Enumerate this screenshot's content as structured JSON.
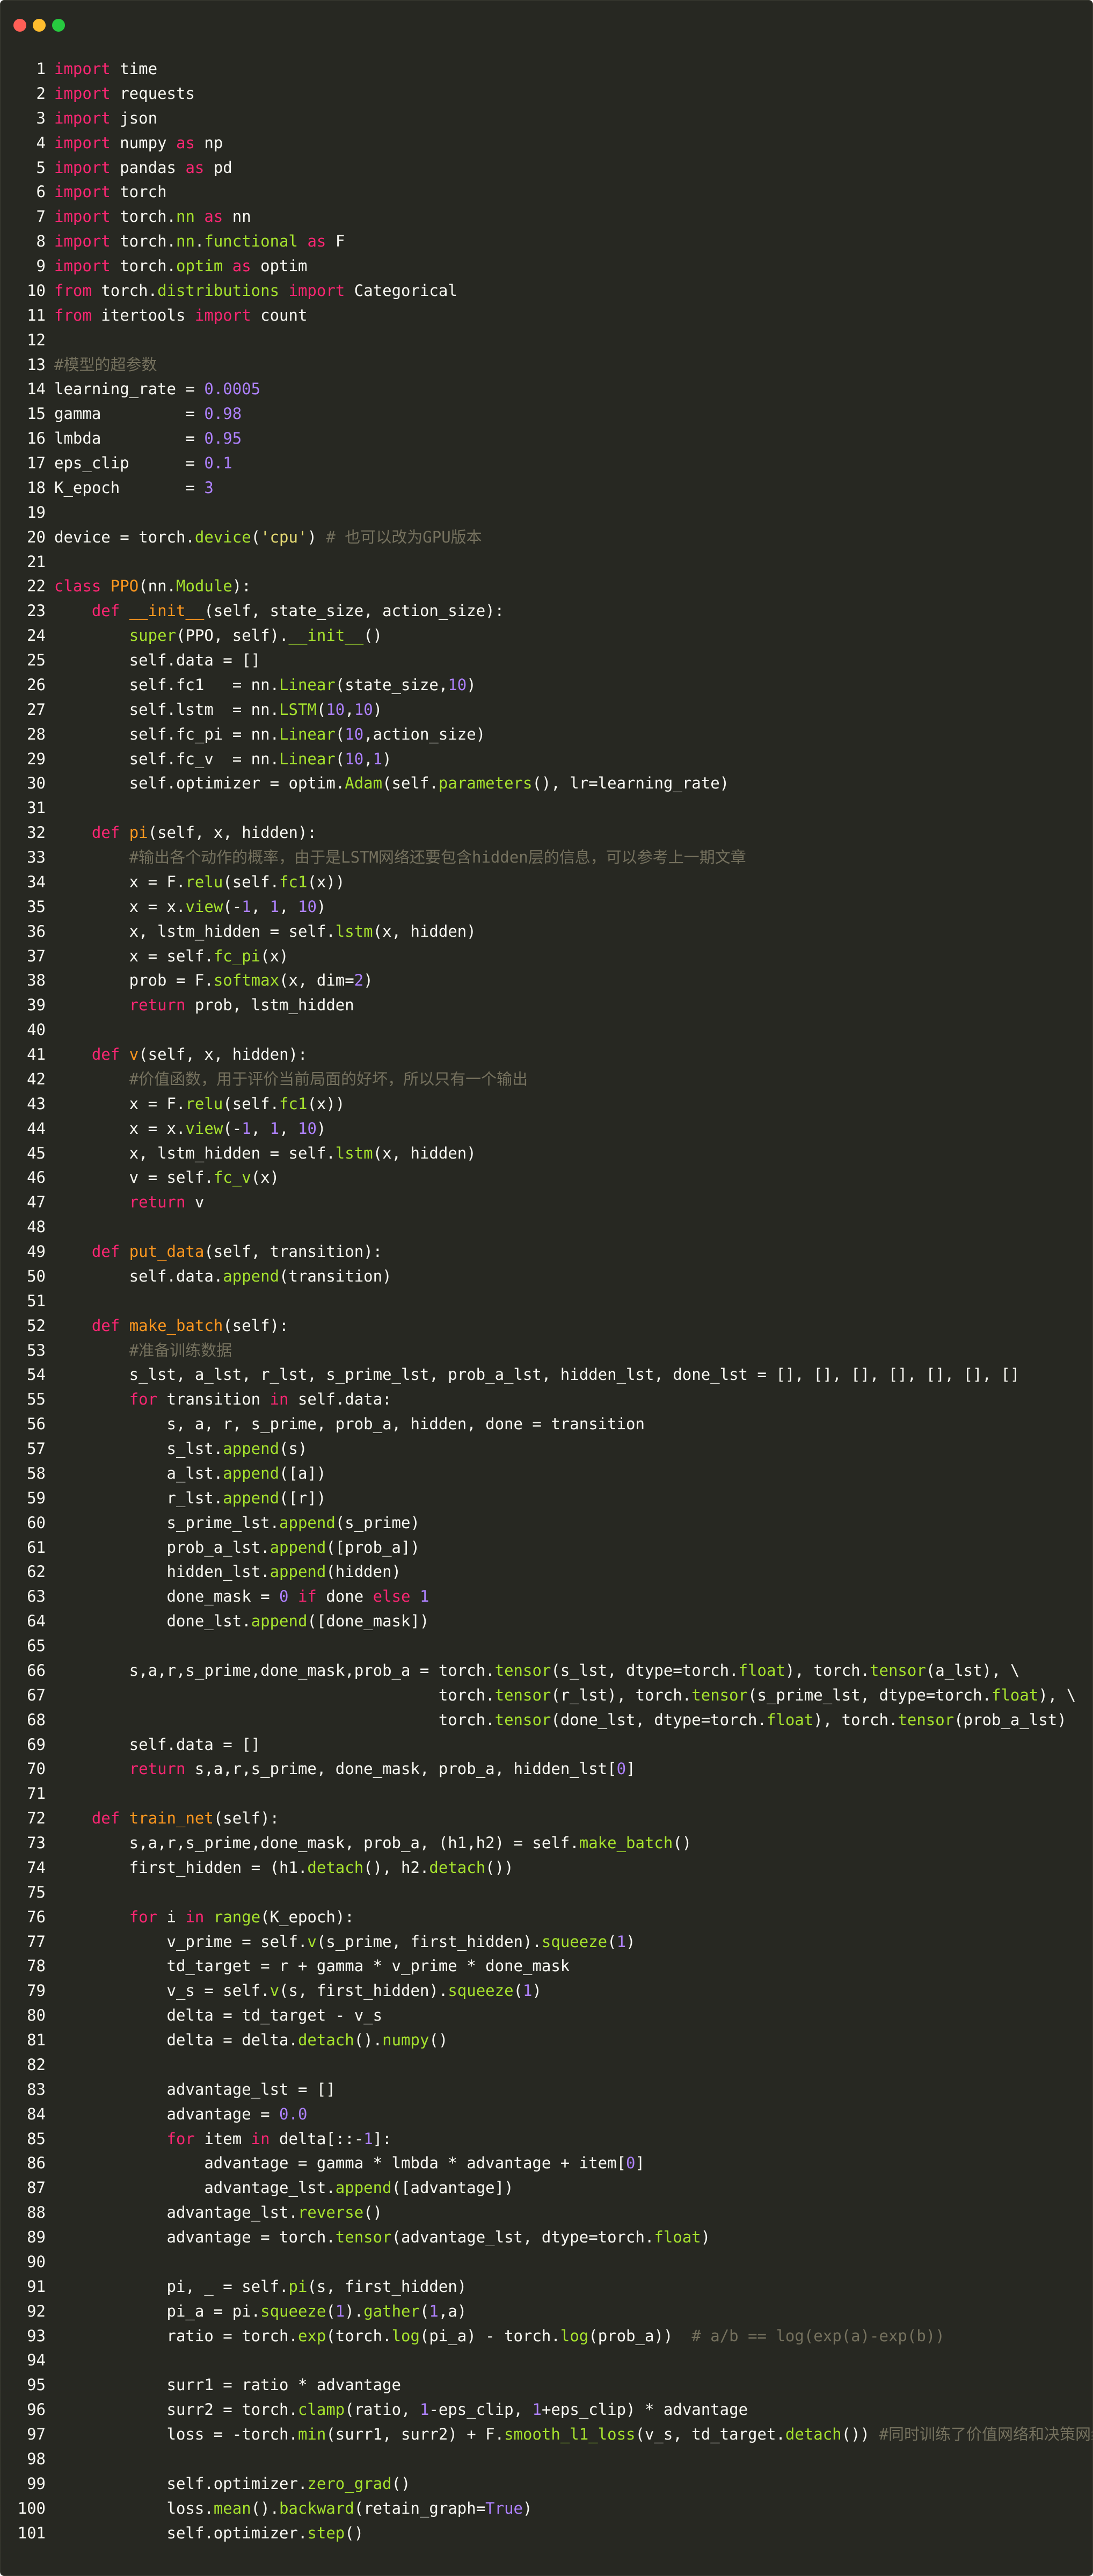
{
  "window": {
    "buttons": [
      {
        "name": "close-window-button",
        "color": "#ff5f56"
      },
      {
        "name": "minimize-window-button",
        "color": "#ffbd2e"
      },
      {
        "name": "maximize-window-button",
        "color": "#27c93f"
      }
    ]
  },
  "code_lines": [
    [
      [
        "k",
        "import"
      ],
      [
        "p",
        " time"
      ]
    ],
    [
      [
        "k",
        "import"
      ],
      [
        "p",
        " requests"
      ]
    ],
    [
      [
        "k",
        "import"
      ],
      [
        "p",
        " json"
      ]
    ],
    [
      [
        "k",
        "import"
      ],
      [
        "p",
        " numpy "
      ],
      [
        "k",
        "as"
      ],
      [
        "p",
        " np"
      ]
    ],
    [
      [
        "k",
        "import"
      ],
      [
        "p",
        " pandas "
      ],
      [
        "k",
        "as"
      ],
      [
        "p",
        " pd"
      ]
    ],
    [
      [
        "k",
        "import"
      ],
      [
        "p",
        " torch"
      ]
    ],
    [
      [
        "k",
        "import"
      ],
      [
        "p",
        " torch."
      ],
      [
        "f",
        "nn"
      ],
      [
        "p",
        " "
      ],
      [
        "k",
        "as"
      ],
      [
        "p",
        " nn"
      ]
    ],
    [
      [
        "k",
        "import"
      ],
      [
        "p",
        " torch."
      ],
      [
        "f",
        "nn"
      ],
      [
        "p",
        "."
      ],
      [
        "f",
        "functional"
      ],
      [
        "p",
        " "
      ],
      [
        "k",
        "as"
      ],
      [
        "p",
        " F"
      ]
    ],
    [
      [
        "k",
        "import"
      ],
      [
        "p",
        " torch."
      ],
      [
        "f",
        "optim"
      ],
      [
        "p",
        " "
      ],
      [
        "k",
        "as"
      ],
      [
        "p",
        " optim"
      ]
    ],
    [
      [
        "k",
        "from"
      ],
      [
        "p",
        " torch."
      ],
      [
        "f",
        "distributions"
      ],
      [
        "p",
        " "
      ],
      [
        "k",
        "import"
      ],
      [
        "p",
        " Categorical"
      ]
    ],
    [
      [
        "k",
        "from"
      ],
      [
        "p",
        " itertools "
      ],
      [
        "k",
        "import"
      ],
      [
        "p",
        " count"
      ]
    ],
    [],
    [
      [
        "c",
        "#模型的超参数"
      ]
    ],
    [
      [
        "p",
        "learning_rate = "
      ],
      [
        "n",
        "0.0005"
      ]
    ],
    [
      [
        "p",
        "gamma         = "
      ],
      [
        "n",
        "0.98"
      ]
    ],
    [
      [
        "p",
        "lmbda         = "
      ],
      [
        "n",
        "0.95"
      ]
    ],
    [
      [
        "p",
        "eps_clip      = "
      ],
      [
        "n",
        "0.1"
      ]
    ],
    [
      [
        "p",
        "K_epoch       = "
      ],
      [
        "n",
        "3"
      ]
    ],
    [],
    [
      [
        "p",
        "device = torch."
      ],
      [
        "f",
        "device"
      ],
      [
        "p",
        "("
      ],
      [
        "s",
        "'cpu'"
      ],
      [
        "p",
        ") "
      ],
      [
        "c",
        "# 也可以改为GPU版本"
      ]
    ],
    [],
    [
      [
        "k",
        "class"
      ],
      [
        "p",
        " "
      ],
      [
        "d",
        "PPO"
      ],
      [
        "p",
        "(nn."
      ],
      [
        "f",
        "Module"
      ],
      [
        "p",
        "):"
      ]
    ],
    [
      [
        "p",
        "    "
      ],
      [
        "k",
        "def"
      ],
      [
        "p",
        " "
      ],
      [
        "d",
        "__init__"
      ],
      [
        "p",
        "(self, state_size, action_size):"
      ]
    ],
    [
      [
        "p",
        "        "
      ],
      [
        "f",
        "super"
      ],
      [
        "p",
        "(PPO, self)."
      ],
      [
        "f",
        "__init__"
      ],
      [
        "p",
        "()"
      ]
    ],
    [
      [
        "p",
        "        self.data = []"
      ]
    ],
    [
      [
        "p",
        "        self.fc1   = nn."
      ],
      [
        "f",
        "Linear"
      ],
      [
        "p",
        "(state_size,"
      ],
      [
        "n",
        "10"
      ],
      [
        "p",
        ")"
      ]
    ],
    [
      [
        "p",
        "        self.lstm  = nn."
      ],
      [
        "f",
        "LSTM"
      ],
      [
        "p",
        "("
      ],
      [
        "n",
        "10"
      ],
      [
        "p",
        ","
      ],
      [
        "n",
        "10"
      ],
      [
        "p",
        ")"
      ]
    ],
    [
      [
        "p",
        "        self.fc_pi = nn."
      ],
      [
        "f",
        "Linear"
      ],
      [
        "p",
        "("
      ],
      [
        "n",
        "10"
      ],
      [
        "p",
        ",action_size)"
      ]
    ],
    [
      [
        "p",
        "        self.fc_v  = nn."
      ],
      [
        "f",
        "Linear"
      ],
      [
        "p",
        "("
      ],
      [
        "n",
        "10"
      ],
      [
        "p",
        ","
      ],
      [
        "n",
        "1"
      ],
      [
        "p",
        ")"
      ]
    ],
    [
      [
        "p",
        "        self.optimizer = optim."
      ],
      [
        "f",
        "Adam"
      ],
      [
        "p",
        "(self."
      ],
      [
        "f",
        "parameters"
      ],
      [
        "p",
        "(), lr=learning_rate)"
      ]
    ],
    [],
    [
      [
        "p",
        "    "
      ],
      [
        "k",
        "def"
      ],
      [
        "p",
        " "
      ],
      [
        "d",
        "pi"
      ],
      [
        "p",
        "(self, x, hidden):"
      ]
    ],
    [
      [
        "p",
        "        "
      ],
      [
        "c",
        "#输出各个动作的概率，由于是LSTM网络还要包含hidden层的信息，可以参考上一期文章"
      ]
    ],
    [
      [
        "p",
        "        x = F."
      ],
      [
        "f",
        "relu"
      ],
      [
        "p",
        "(self."
      ],
      [
        "f",
        "fc1"
      ],
      [
        "p",
        "(x))"
      ]
    ],
    [
      [
        "p",
        "        x = x."
      ],
      [
        "f",
        "view"
      ],
      [
        "p",
        "(-"
      ],
      [
        "n",
        "1"
      ],
      [
        "p",
        ", "
      ],
      [
        "n",
        "1"
      ],
      [
        "p",
        ", "
      ],
      [
        "n",
        "10"
      ],
      [
        "p",
        ")"
      ]
    ],
    [
      [
        "p",
        "        x, lstm_hidden = self."
      ],
      [
        "f",
        "lstm"
      ],
      [
        "p",
        "(x, hidden)"
      ]
    ],
    [
      [
        "p",
        "        x = self."
      ],
      [
        "f",
        "fc_pi"
      ],
      [
        "p",
        "(x)"
      ]
    ],
    [
      [
        "p",
        "        prob = F."
      ],
      [
        "f",
        "softmax"
      ],
      [
        "p",
        "(x, dim="
      ],
      [
        "n",
        "2"
      ],
      [
        "p",
        ")"
      ]
    ],
    [
      [
        "p",
        "        "
      ],
      [
        "k",
        "return"
      ],
      [
        "p",
        " prob, lstm_hidden"
      ]
    ],
    [],
    [
      [
        "p",
        "    "
      ],
      [
        "k",
        "def"
      ],
      [
        "p",
        " "
      ],
      [
        "d",
        "v"
      ],
      [
        "p",
        "(self, x, hidden):"
      ]
    ],
    [
      [
        "p",
        "        "
      ],
      [
        "c",
        "#价值函数，用于评价当前局面的好坏，所以只有一个输出"
      ]
    ],
    [
      [
        "p",
        "        x = F."
      ],
      [
        "f",
        "relu"
      ],
      [
        "p",
        "(self."
      ],
      [
        "f",
        "fc1"
      ],
      [
        "p",
        "(x))"
      ]
    ],
    [
      [
        "p",
        "        x = x."
      ],
      [
        "f",
        "view"
      ],
      [
        "p",
        "(-"
      ],
      [
        "n",
        "1"
      ],
      [
        "p",
        ", "
      ],
      [
        "n",
        "1"
      ],
      [
        "p",
        ", "
      ],
      [
        "n",
        "10"
      ],
      [
        "p",
        ")"
      ]
    ],
    [
      [
        "p",
        "        x, lstm_hidden = self."
      ],
      [
        "f",
        "lstm"
      ],
      [
        "p",
        "(x, hidden)"
      ]
    ],
    [
      [
        "p",
        "        v = self."
      ],
      [
        "f",
        "fc_v"
      ],
      [
        "p",
        "(x)"
      ]
    ],
    [
      [
        "p",
        "        "
      ],
      [
        "k",
        "return"
      ],
      [
        "p",
        " v"
      ]
    ],
    [],
    [
      [
        "p",
        "    "
      ],
      [
        "k",
        "def"
      ],
      [
        "p",
        " "
      ],
      [
        "d",
        "put_data"
      ],
      [
        "p",
        "(self, transition):"
      ]
    ],
    [
      [
        "p",
        "        self.data."
      ],
      [
        "f",
        "append"
      ],
      [
        "p",
        "(transition)"
      ]
    ],
    [],
    [
      [
        "p",
        "    "
      ],
      [
        "k",
        "def"
      ],
      [
        "p",
        " "
      ],
      [
        "d",
        "make_batch"
      ],
      [
        "p",
        "(self):"
      ]
    ],
    [
      [
        "p",
        "        "
      ],
      [
        "c",
        "#准备训练数据"
      ]
    ],
    [
      [
        "p",
        "        s_lst, a_lst, r_lst, s_prime_lst, prob_a_lst, hidden_lst, done_lst = [], [], [], [], [], [], []"
      ]
    ],
    [
      [
        "p",
        "        "
      ],
      [
        "k",
        "for"
      ],
      [
        "p",
        " transition "
      ],
      [
        "k",
        "in"
      ],
      [
        "p",
        " self.data:"
      ]
    ],
    [
      [
        "p",
        "            s, a, r, s_prime, prob_a, hidden, done = transition"
      ]
    ],
    [
      [
        "p",
        "            s_lst."
      ],
      [
        "f",
        "append"
      ],
      [
        "p",
        "(s)"
      ]
    ],
    [
      [
        "p",
        "            a_lst."
      ],
      [
        "f",
        "append"
      ],
      [
        "p",
        "([a])"
      ]
    ],
    [
      [
        "p",
        "            r_lst."
      ],
      [
        "f",
        "append"
      ],
      [
        "p",
        "([r])"
      ]
    ],
    [
      [
        "p",
        "            s_prime_lst."
      ],
      [
        "f",
        "append"
      ],
      [
        "p",
        "(s_prime)"
      ]
    ],
    [
      [
        "p",
        "            prob_a_lst."
      ],
      [
        "f",
        "append"
      ],
      [
        "p",
        "([prob_a])"
      ]
    ],
    [
      [
        "p",
        "            hidden_lst."
      ],
      [
        "f",
        "append"
      ],
      [
        "p",
        "(hidden)"
      ]
    ],
    [
      [
        "p",
        "            done_mask = "
      ],
      [
        "n",
        "0"
      ],
      [
        "p",
        " "
      ],
      [
        "k",
        "if"
      ],
      [
        "p",
        " done "
      ],
      [
        "k",
        "else"
      ],
      [
        "p",
        " "
      ],
      [
        "n",
        "1"
      ]
    ],
    [
      [
        "p",
        "            done_lst."
      ],
      [
        "f",
        "append"
      ],
      [
        "p",
        "([done_mask])"
      ]
    ],
    [],
    [
      [
        "p",
        "        s,a,r,s_prime,done_mask,prob_a = torch."
      ],
      [
        "f",
        "tensor"
      ],
      [
        "p",
        "(s_lst, dtype=torch."
      ],
      [
        "f",
        "float"
      ],
      [
        "p",
        "), torch."
      ],
      [
        "f",
        "tensor"
      ],
      [
        "p",
        "(a_lst), \\"
      ]
    ],
    [
      [
        "p",
        "                                         torch."
      ],
      [
        "f",
        "tensor"
      ],
      [
        "p",
        "(r_lst), torch."
      ],
      [
        "f",
        "tensor"
      ],
      [
        "p",
        "(s_prime_lst, dtype=torch."
      ],
      [
        "f",
        "float"
      ],
      [
        "p",
        "), \\"
      ]
    ],
    [
      [
        "p",
        "                                         torch."
      ],
      [
        "f",
        "tensor"
      ],
      [
        "p",
        "(done_lst, dtype=torch."
      ],
      [
        "f",
        "float"
      ],
      [
        "p",
        "), torch."
      ],
      [
        "f",
        "tensor"
      ],
      [
        "p",
        "(prob_a_lst)"
      ]
    ],
    [
      [
        "p",
        "        self.data = []"
      ]
    ],
    [
      [
        "p",
        "        "
      ],
      [
        "k",
        "return"
      ],
      [
        "p",
        " s,a,r,s_prime, done_mask, prob_a, hidden_lst["
      ],
      [
        "n",
        "0"
      ],
      [
        "p",
        "]"
      ]
    ],
    [],
    [
      [
        "p",
        "    "
      ],
      [
        "k",
        "def"
      ],
      [
        "p",
        " "
      ],
      [
        "d",
        "train_net"
      ],
      [
        "p",
        "(self):"
      ]
    ],
    [
      [
        "p",
        "        s,a,r,s_prime,done_mask, prob_a, (h1,h2) = self."
      ],
      [
        "f",
        "make_batch"
      ],
      [
        "p",
        "()"
      ]
    ],
    [
      [
        "p",
        "        first_hidden = (h1."
      ],
      [
        "f",
        "detach"
      ],
      [
        "p",
        "(), h2."
      ],
      [
        "f",
        "detach"
      ],
      [
        "p",
        "())"
      ]
    ],
    [],
    [
      [
        "p",
        "        "
      ],
      [
        "k",
        "for"
      ],
      [
        "p",
        " i "
      ],
      [
        "k",
        "in"
      ],
      [
        "p",
        " "
      ],
      [
        "f",
        "range"
      ],
      [
        "p",
        "(K_epoch):"
      ]
    ],
    [
      [
        "p",
        "            v_prime = self."
      ],
      [
        "f",
        "v"
      ],
      [
        "p",
        "(s_prime, first_hidden)."
      ],
      [
        "f",
        "squeeze"
      ],
      [
        "p",
        "("
      ],
      [
        "n",
        "1"
      ],
      [
        "p",
        ")"
      ]
    ],
    [
      [
        "p",
        "            td_target = r + gamma * v_prime * done_mask"
      ]
    ],
    [
      [
        "p",
        "            v_s = self."
      ],
      [
        "f",
        "v"
      ],
      [
        "p",
        "(s, first_hidden)."
      ],
      [
        "f",
        "squeeze"
      ],
      [
        "p",
        "("
      ],
      [
        "n",
        "1"
      ],
      [
        "p",
        ")"
      ]
    ],
    [
      [
        "p",
        "            delta = td_target - v_s"
      ]
    ],
    [
      [
        "p",
        "            delta = delta."
      ],
      [
        "f",
        "detach"
      ],
      [
        "p",
        "()."
      ],
      [
        "f",
        "numpy"
      ],
      [
        "p",
        "()"
      ]
    ],
    [],
    [
      [
        "p",
        "            advantage_lst = []"
      ]
    ],
    [
      [
        "p",
        "            advantage = "
      ],
      [
        "n",
        "0.0"
      ]
    ],
    [
      [
        "p",
        "            "
      ],
      [
        "k",
        "for"
      ],
      [
        "p",
        " item "
      ],
      [
        "k",
        "in"
      ],
      [
        "p",
        " delta[::-"
      ],
      [
        "n",
        "1"
      ],
      [
        "p",
        "]:"
      ]
    ],
    [
      [
        "p",
        "                advantage = gamma * lmbda * advantage + item["
      ],
      [
        "n",
        "0"
      ],
      [
        "p",
        "]"
      ]
    ],
    [
      [
        "p",
        "                advantage_lst."
      ],
      [
        "f",
        "append"
      ],
      [
        "p",
        "([advantage])"
      ]
    ],
    [
      [
        "p",
        "            advantage_lst."
      ],
      [
        "f",
        "reverse"
      ],
      [
        "p",
        "()"
      ]
    ],
    [
      [
        "p",
        "            advantage = torch."
      ],
      [
        "f",
        "tensor"
      ],
      [
        "p",
        "(advantage_lst, dtype=torch."
      ],
      [
        "f",
        "float"
      ],
      [
        "p",
        ")"
      ]
    ],
    [],
    [
      [
        "p",
        "            pi, _ = self."
      ],
      [
        "f",
        "pi"
      ],
      [
        "p",
        "(s, first_hidden)"
      ]
    ],
    [
      [
        "p",
        "            pi_a = pi."
      ],
      [
        "f",
        "squeeze"
      ],
      [
        "p",
        "("
      ],
      [
        "n",
        "1"
      ],
      [
        "p",
        ")."
      ],
      [
        "f",
        "gather"
      ],
      [
        "p",
        "("
      ],
      [
        "n",
        "1"
      ],
      [
        "p",
        ",a)"
      ]
    ],
    [
      [
        "p",
        "            ratio = torch."
      ],
      [
        "f",
        "exp"
      ],
      [
        "p",
        "(torch."
      ],
      [
        "f",
        "log"
      ],
      [
        "p",
        "(pi_a) - torch."
      ],
      [
        "f",
        "log"
      ],
      [
        "p",
        "(prob_a))  "
      ],
      [
        "c",
        "# a/b == log(exp(a)-exp(b))"
      ]
    ],
    [],
    [
      [
        "p",
        "            surr1 = ratio * advantage"
      ]
    ],
    [
      [
        "p",
        "            surr2 = torch."
      ],
      [
        "f",
        "clamp"
      ],
      [
        "p",
        "(ratio, "
      ],
      [
        "n",
        "1"
      ],
      [
        "p",
        "-eps_clip, "
      ],
      [
        "n",
        "1"
      ],
      [
        "p",
        "+eps_clip) * advantage"
      ]
    ],
    [
      [
        "p",
        "            loss = -torch."
      ],
      [
        "f",
        "min"
      ],
      [
        "p",
        "(surr1, surr2) + F."
      ],
      [
        "f",
        "smooth_l1_loss"
      ],
      [
        "p",
        "(v_s, td_target."
      ],
      [
        "f",
        "detach"
      ],
      [
        "p",
        "()) "
      ],
      [
        "c",
        "#同时训练了价值网络和决策网络"
      ]
    ],
    [],
    [
      [
        "p",
        "            self.optimizer."
      ],
      [
        "f",
        "zero_grad"
      ],
      [
        "p",
        "()"
      ]
    ],
    [
      [
        "p",
        "            loss."
      ],
      [
        "f",
        "mean"
      ],
      [
        "p",
        "()."
      ],
      [
        "f",
        "backward"
      ],
      [
        "p",
        "(retain_graph="
      ],
      [
        "n",
        "True"
      ],
      [
        "p",
        ")"
      ]
    ],
    [
      [
        "p",
        "            self.optimizer."
      ],
      [
        "f",
        "step"
      ],
      [
        "p",
        "()"
      ]
    ]
  ]
}
